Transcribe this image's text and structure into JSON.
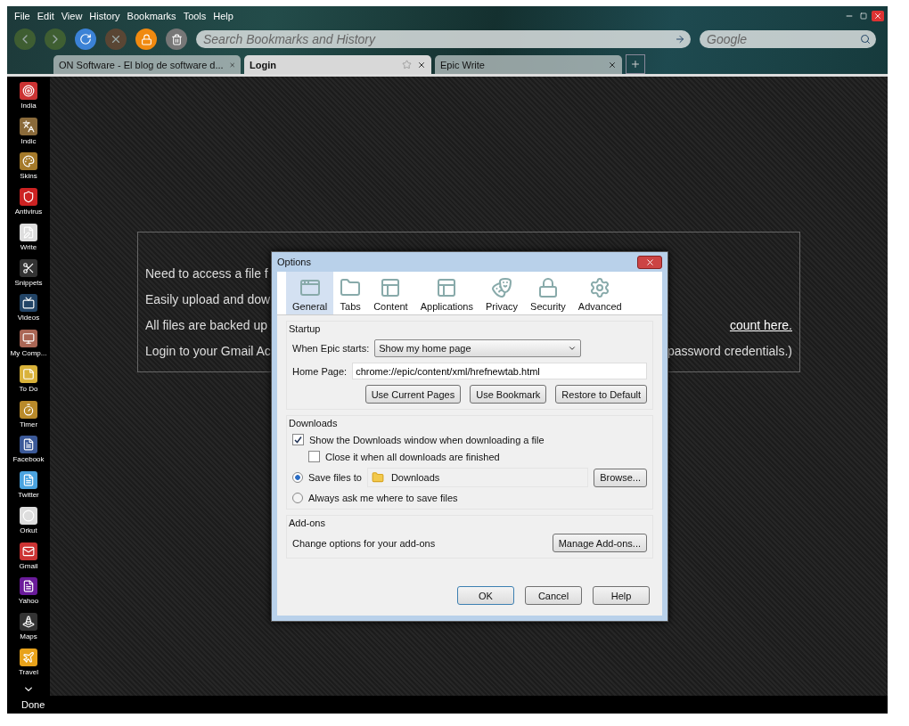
{
  "menu": [
    "File",
    "Edit",
    "View",
    "History",
    "Bookmarks",
    "Tools",
    "Help"
  ],
  "toolbar": {
    "back_disabled": true,
    "forward_disabled": true,
    "stop_disabled": true,
    "search": {
      "placeholder": "Search Bookmarks and History"
    },
    "engine_search": {
      "placeholder": "Google"
    }
  },
  "tabs": [
    {
      "label": "ON Software - El blog de software d...",
      "selected": false
    },
    {
      "label": "Login",
      "selected": true
    },
    {
      "label": "Epic Write",
      "selected": false
    }
  ],
  "sidebar": {
    "items": [
      {
        "label": "India"
      },
      {
        "label": "Indic"
      },
      {
        "label": "Skins"
      },
      {
        "label": "Antivirus"
      },
      {
        "label": "Write"
      },
      {
        "label": "Snippets"
      },
      {
        "label": "Videos"
      },
      {
        "label": "My Comp..."
      },
      {
        "label": "To Do"
      },
      {
        "label": "Timer"
      },
      {
        "label": "Facebook"
      },
      {
        "label": "Twitter"
      },
      {
        "label": "Orkut"
      },
      {
        "label": "Gmail"
      },
      {
        "label": "Yahoo"
      },
      {
        "label": "Maps"
      },
      {
        "label": "Travel"
      }
    ]
  },
  "page": {
    "lines": [
      {
        "left": "Need to access a file f"
      },
      {
        "left": "Easily upload and dow"
      },
      {
        "left": "All files are backed up",
        "right": "count here.",
        "right_link": true
      },
      {
        "left": "Login to your Gmail Ac",
        "right": "password credentials.)",
        "right_link": false
      }
    ]
  },
  "dialog": {
    "title": "Options",
    "panes": [
      {
        "label": "General",
        "selected": true
      },
      {
        "label": "Tabs",
        "selected": false
      },
      {
        "label": "Content",
        "selected": false
      },
      {
        "label": "Applications",
        "selected": false
      },
      {
        "label": "Privacy",
        "selected": false
      },
      {
        "label": "Security",
        "selected": false
      },
      {
        "label": "Advanced",
        "selected": false
      }
    ],
    "startup": {
      "heading": "Startup",
      "when_label": "When Epic starts:",
      "when_value": "Show my home page",
      "home_label": "Home Page:",
      "home_value": "chrome://epic/content/xml/hrefnewtab.html",
      "buttons": [
        "Use Current Pages",
        "Use Bookmark",
        "Restore to Default"
      ]
    },
    "downloads": {
      "heading": "Downloads",
      "checks": [
        {
          "label": "Show the Downloads window when downloading a file",
          "checked": true
        },
        {
          "label": "Close it when all downloads are finished",
          "checked": false
        }
      ],
      "save_options": [
        {
          "label": "Save files to",
          "selected": true,
          "folder": "Downloads",
          "button": "Browse..."
        },
        {
          "label": "Always ask me where to save files",
          "selected": false
        }
      ]
    },
    "addons": {
      "heading": "Add-ons",
      "text": "Change options for your add-ons",
      "button": "Manage Add-ons..."
    },
    "buttons": [
      "OK",
      "Cancel",
      "Help"
    ]
  },
  "status_bar": {
    "text": "Done"
  }
}
